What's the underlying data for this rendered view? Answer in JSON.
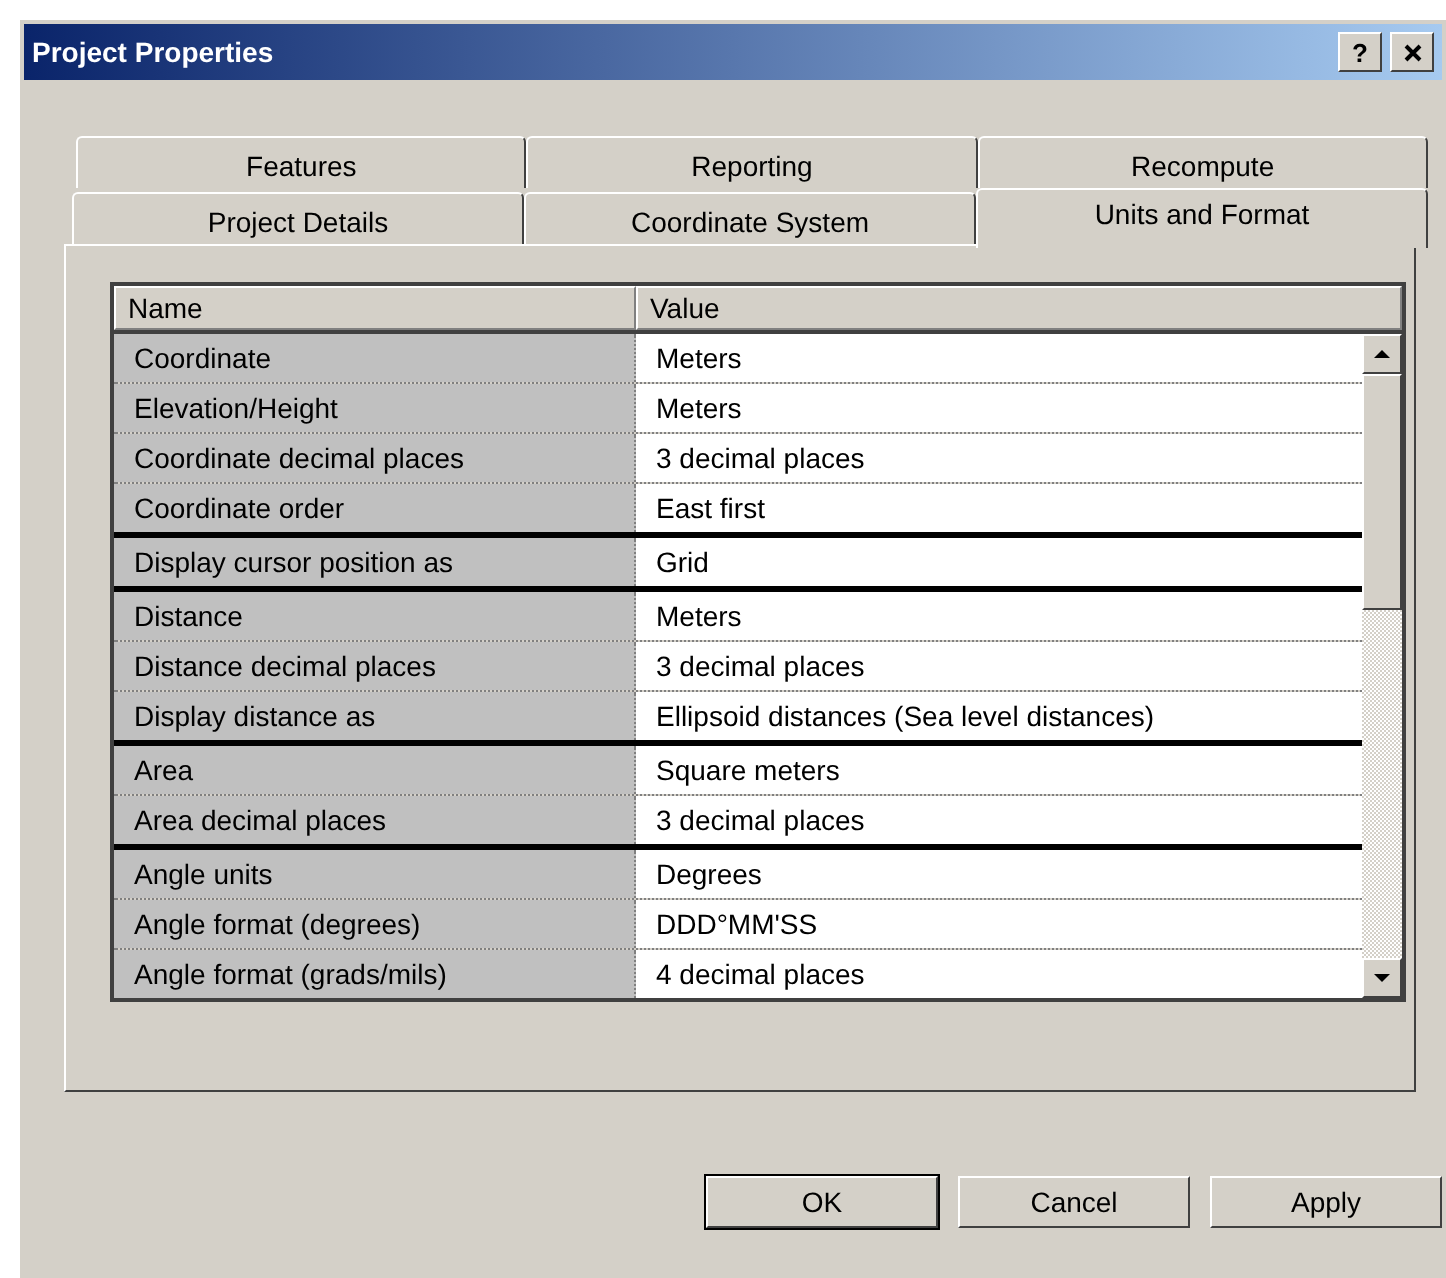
{
  "window": {
    "title": "Project Properties",
    "help_button": "?"
  },
  "tab_rows": [
    {
      "tabs": [
        {
          "label": "Features",
          "selected": false
        },
        {
          "label": "Reporting",
          "selected": false
        },
        {
          "label": "Recompute",
          "selected": false
        }
      ]
    },
    {
      "tabs": [
        {
          "label": "Project Details",
          "selected": false
        },
        {
          "label": "Coordinate System",
          "selected": false
        },
        {
          "label": "Units and Format",
          "selected": true
        }
      ]
    }
  ],
  "table": {
    "columns": [
      "Name",
      "Value"
    ],
    "groups": [
      {
        "rows": [
          {
            "name": "Coordinate",
            "value": "Meters"
          },
          {
            "name": "Elevation/Height",
            "value": "Meters"
          },
          {
            "name": "Coordinate decimal places",
            "value": "3 decimal places"
          },
          {
            "name": "Coordinate order",
            "value": "East first"
          }
        ]
      },
      {
        "rows": [
          {
            "name": "Display cursor position as",
            "value": "Grid"
          }
        ]
      },
      {
        "rows": [
          {
            "name": "Distance",
            "value": "Meters"
          },
          {
            "name": "Distance decimal places",
            "value": "3 decimal places"
          },
          {
            "name": "Display distance as",
            "value": "Ellipsoid distances (Sea level distances)"
          }
        ]
      },
      {
        "rows": [
          {
            "name": "Area",
            "value": "Square meters"
          },
          {
            "name": "Area decimal places",
            "value": "3 decimal places"
          }
        ]
      },
      {
        "rows": [
          {
            "name": "Angle units",
            "value": "Degrees"
          },
          {
            "name": "Angle format (degrees)",
            "value": "DDD°MM'SS"
          },
          {
            "name": "Angle format (grads/mils)",
            "value": "4 decimal places"
          }
        ]
      }
    ]
  },
  "buttons": [
    {
      "label": "OK",
      "default": true
    },
    {
      "label": "Cancel",
      "default": false
    },
    {
      "label": "Apply",
      "default": false
    }
  ]
}
